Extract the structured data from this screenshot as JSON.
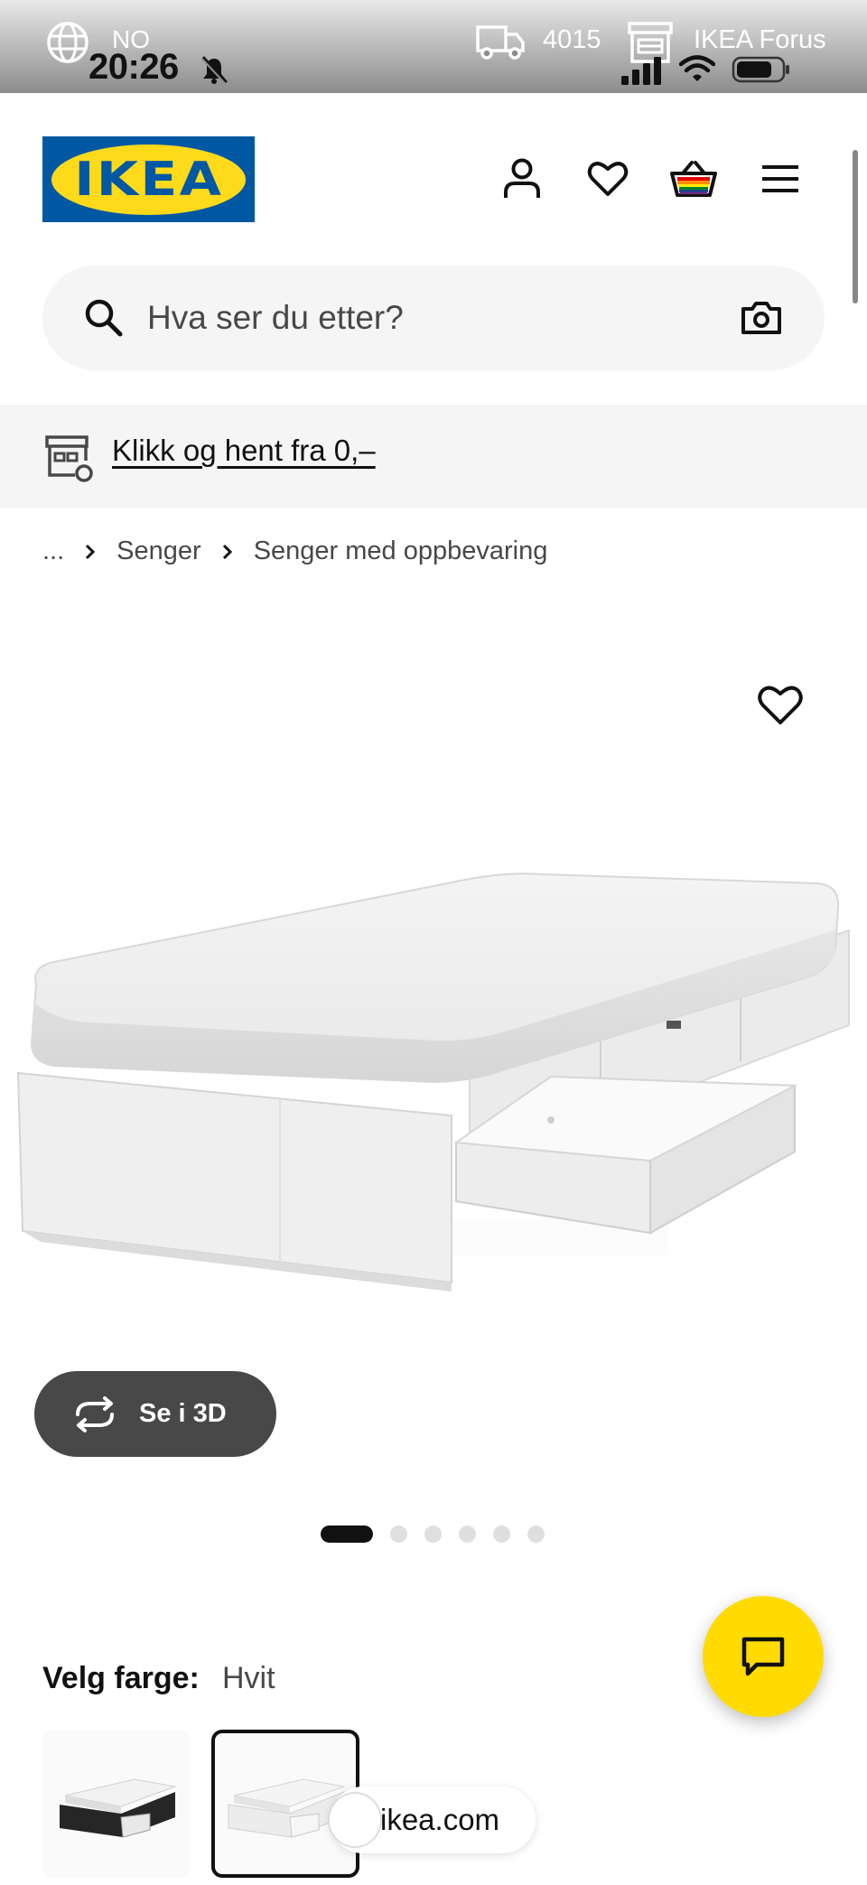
{
  "status_bar": {
    "country": "NO",
    "time": "20:26",
    "postal_code": "4015",
    "store_name": "IKEA Forus"
  },
  "header": {
    "logo_text": "IKEA",
    "icons": [
      "account-icon",
      "heart-icon",
      "basket-icon",
      "menu-icon"
    ]
  },
  "search": {
    "placeholder": "Hva ser du etter?"
  },
  "promo": {
    "link_text": "Klikk og hent fra 0,–"
  },
  "breadcrumb": {
    "items": [
      "...",
      "Senger",
      "Senger med oppbevaring"
    ]
  },
  "gallery": {
    "view_3d_label": "Se i 3D",
    "image_count": 6,
    "active_index": 0
  },
  "color_selector": {
    "label": "Velg farge:",
    "selected_value": "Hvit",
    "swatches": [
      "black-white",
      "white"
    ]
  },
  "browser": {
    "url_label": "ikea.com"
  },
  "colors": {
    "ikea_blue": "#0058a3",
    "ikea_yellow": "#ffda1a",
    "chat_yellow": "#ffdb00",
    "dark_button": "#484848"
  }
}
